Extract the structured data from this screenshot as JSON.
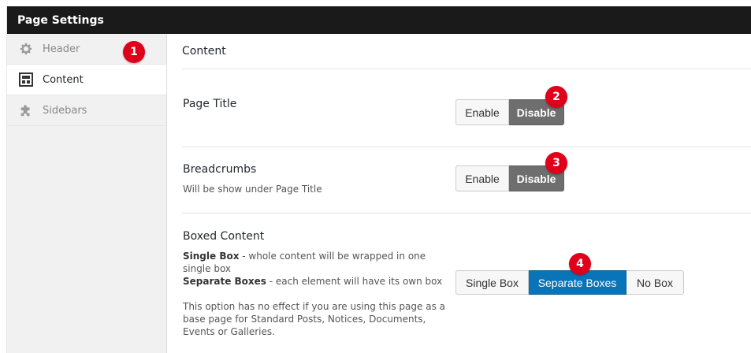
{
  "window": {
    "title": "Page Settings"
  },
  "sidebar": {
    "items": [
      {
        "label": "Header",
        "icon": "gear-icon",
        "active": false
      },
      {
        "label": "Content",
        "icon": "layout-icon",
        "active": true
      },
      {
        "label": "Sidebars",
        "icon": "puzzle-icon",
        "active": false
      }
    ]
  },
  "badges": [
    "1",
    "2",
    "3",
    "4"
  ],
  "main": {
    "section_title": "Content",
    "page_title": {
      "label": "Page Title",
      "options": [
        "Enable",
        "Disable"
      ],
      "selected": "Disable"
    },
    "breadcrumbs": {
      "label": "Breadcrumbs",
      "description": "Will be show under Page Title",
      "options": [
        "Enable",
        "Disable"
      ],
      "selected": "Disable"
    },
    "boxed_content": {
      "label": "Boxed Content",
      "single_box_term": "Single Box",
      "single_box_desc": " - whole content will be wrapped in one single box",
      "separate_term": "Separate Boxes",
      "separate_desc": " - each element will have its own box",
      "note": "This option has no effect if you are using this page as a base page for Standard Posts, Notices, Documents, Events or Galleries.",
      "options": [
        "Single Box",
        "Separate Boxes",
        "No Box"
      ],
      "selected": "Separate Boxes"
    }
  },
  "colors": {
    "titlebar": "#1a1a1a",
    "active_dark": "#6e6e6e",
    "active_blue": "#0a74b8",
    "badge": "#e0001a"
  }
}
